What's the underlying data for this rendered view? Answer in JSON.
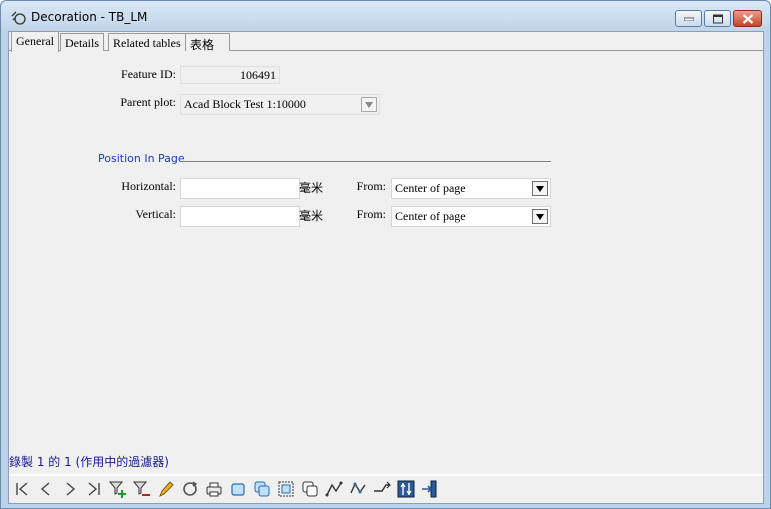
{
  "window": {
    "title": "Decoration - TB_LM",
    "icon": "decoration-app-icon"
  },
  "tabs": [
    {
      "label": "General",
      "active": true
    },
    {
      "label": "Details",
      "active": false
    },
    {
      "label": "Related tables",
      "active": false
    },
    {
      "label": "表格",
      "active": false
    }
  ],
  "form": {
    "feature_id_label": "Feature ID:",
    "feature_id_value": "106491",
    "parent_plot_label": "Parent plot:",
    "parent_plot_value": "Acad Block Test 1:10000",
    "section_title": "Position In Page",
    "horizontal_label": "Horizontal:",
    "horizontal_value": "",
    "horizontal_unit": "毫米",
    "horizontal_from_label": "From:",
    "horizontal_from_value": "Center of page",
    "vertical_label": "Vertical:",
    "vertical_value": "",
    "vertical_unit": "毫米",
    "vertical_from_label": "From:",
    "vertical_from_value": "Center of page"
  },
  "status": {
    "record_text": "錄製 1 的 1 (作用中的過濾器)"
  },
  "toolbar": {
    "buttons": [
      "first-record-icon",
      "previous-record-icon",
      "next-record-icon",
      "last-record-icon",
      "add-filter-icon",
      "remove-filter-icon",
      "edit-pencil-icon",
      "refresh-icon",
      "print-icon",
      "select-icon",
      "select-multiple-icon",
      "zoom-select-icon",
      "copy-shape-icon",
      "path-icon",
      "path-alt-icon",
      "route-icon",
      "columns-icon",
      "pin-icon"
    ]
  },
  "colors": {
    "section_title": "#1a3bbd",
    "status_text": "#1a1a9a",
    "close_button": "#c7432b"
  }
}
